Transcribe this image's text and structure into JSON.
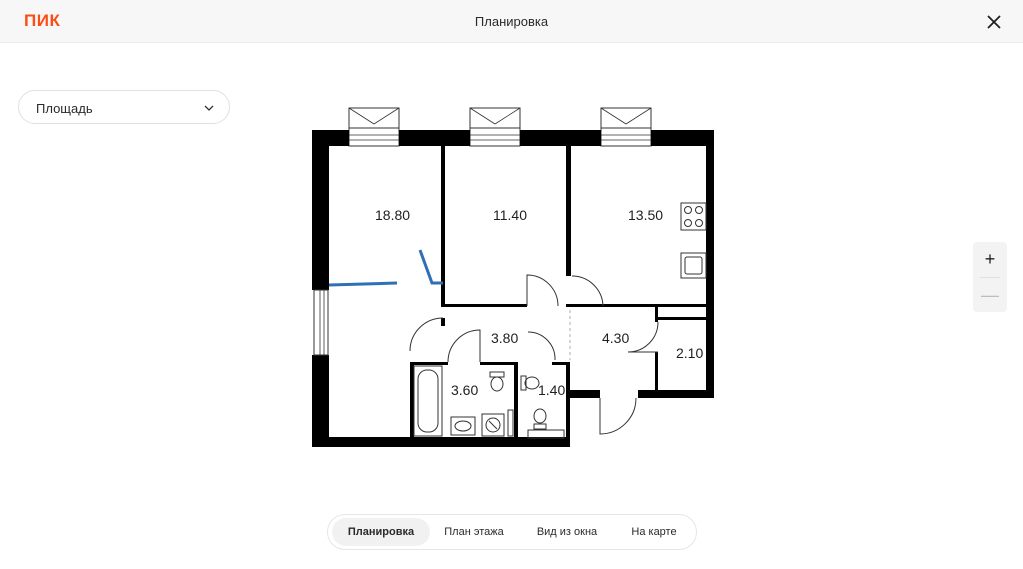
{
  "header": {
    "logo": "ПИК",
    "title": "Планировка"
  },
  "filter": {
    "selected": "Площадь"
  },
  "plan": {
    "rooms": [
      {
        "area": "18.80"
      },
      {
        "area": "11.40"
      },
      {
        "area": "13.50"
      },
      {
        "area": "3.80"
      },
      {
        "area": "4.30"
      },
      {
        "area": "2.10"
      },
      {
        "area": "3.60"
      },
      {
        "area": "1.40"
      }
    ]
  },
  "zoom": {
    "plus": "+",
    "minus": "—"
  },
  "tabs": [
    {
      "label": "Планировка"
    },
    {
      "label": "План этажа"
    },
    {
      "label": "Вид из окна"
    },
    {
      "label": "На карте"
    }
  ],
  "colors": {
    "brand": "#fb4d14",
    "wall": "#000000",
    "accent_line": "#2f6fb5"
  }
}
